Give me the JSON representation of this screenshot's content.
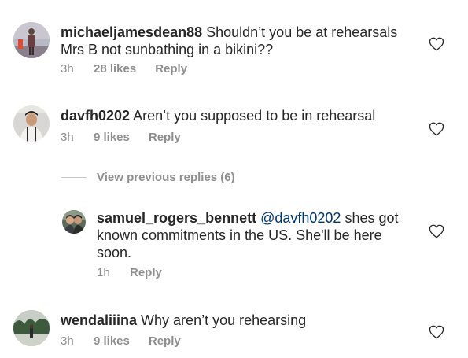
{
  "comments": [
    {
      "username": "michaeljamesdean88",
      "text": "Shouldn’t you be at rehearsals Mrs B not sunbathing in a bikini??",
      "time": "3h",
      "likes": "28 likes",
      "reply": "Reply"
    },
    {
      "username": "davfh0202",
      "text": "Aren’t you supposed to be in rehearsal",
      "time": "3h",
      "likes": "9 likes",
      "reply": "Reply"
    },
    {
      "username": "samuel_rogers_bennett",
      "mention": "@davfh0202",
      "text": "shes got known commitments in the US. She'll be here soon.",
      "time": "1h",
      "reply": "Reply"
    },
    {
      "username": "wendaliiina",
      "text": "Why aren’t you rehearsing",
      "time": "3h",
      "likes": "9 likes",
      "reply": "Reply"
    }
  ],
  "view_previous_replies": "View previous replies (6)",
  "icons": {
    "like": "heart-outline-icon"
  },
  "colors": {
    "text": "#262626",
    "meta": "#8e8e8e",
    "mention": "#003569"
  }
}
